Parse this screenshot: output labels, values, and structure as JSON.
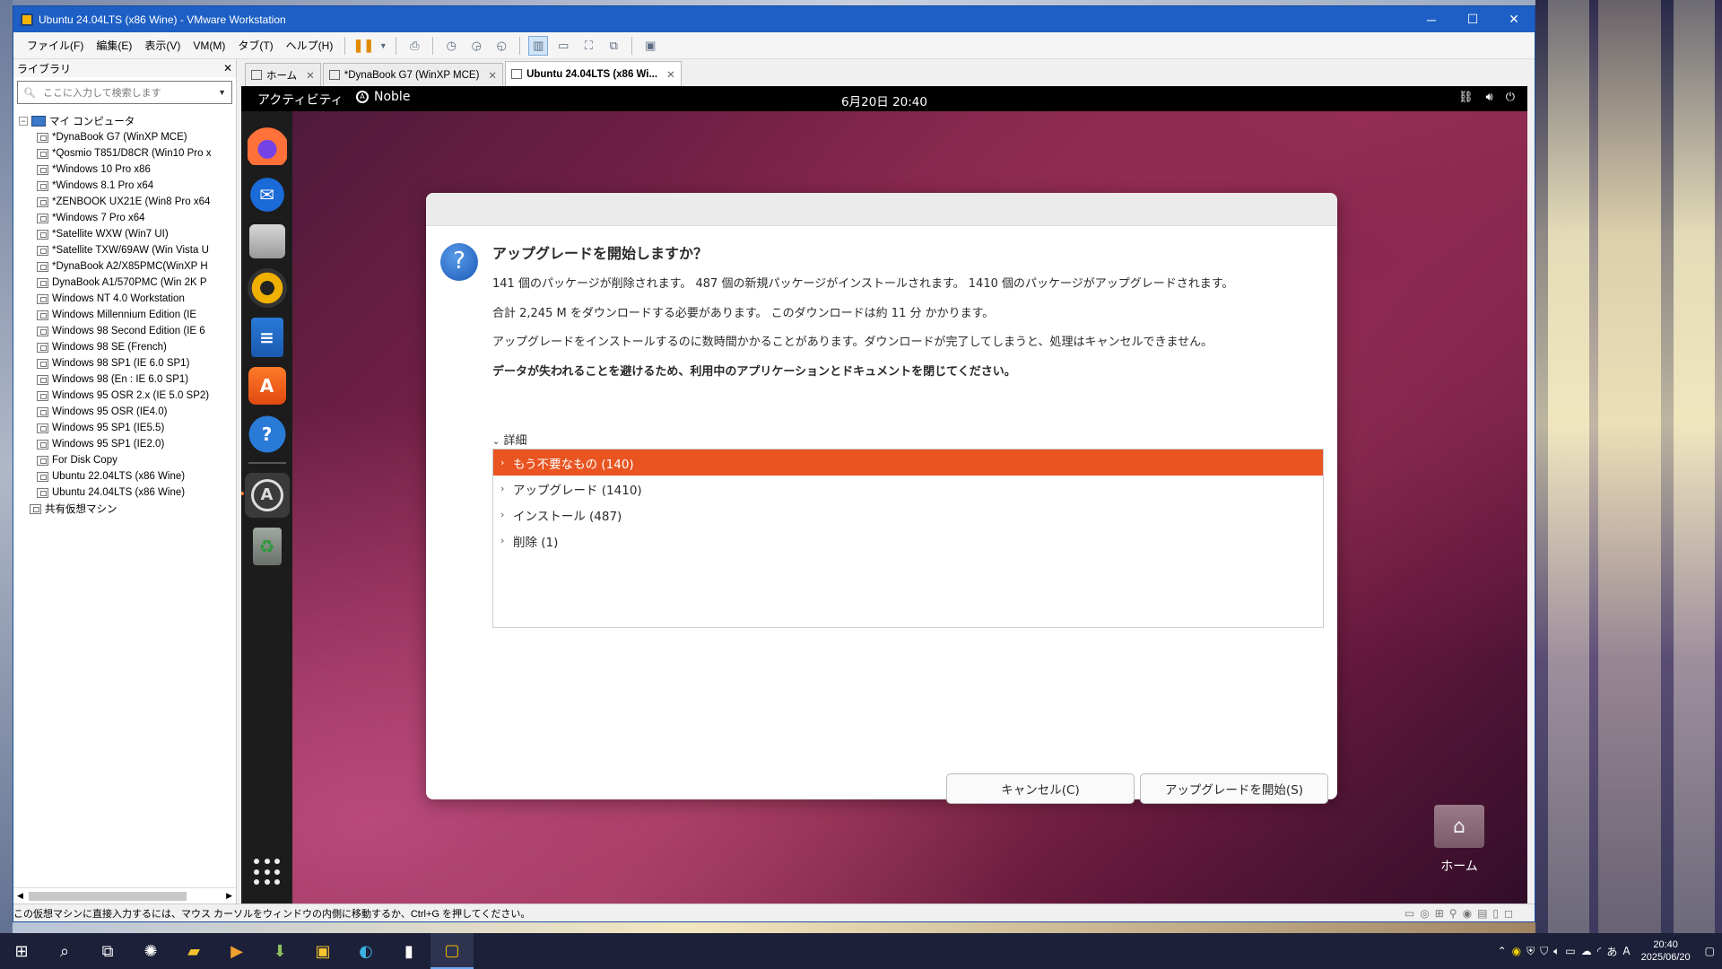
{
  "vmware": {
    "title": "Ubuntu 24.04LTS (x86 Wine) - VMware Workstation",
    "menu": [
      "ファイル(F)",
      "編集(E)",
      "表示(V)",
      "VM(M)",
      "タブ(T)",
      "ヘルプ(H)"
    ],
    "library": {
      "title": "ライブラリ",
      "search_placeholder": "ここに入力して検索します",
      "root": "マイ コンピュータ",
      "shared": "共有仮想マシン",
      "items": [
        "*DynaBook G7 (WinXP MCE)",
        "*Qosmio T851/D8CR (Win10 Pro x",
        "*Windows 10 Pro x86",
        "*Windows 8.1 Pro x64",
        "*ZENBOOK UX21E (Win8 Pro x64",
        "*Windows 7 Pro x64",
        "*Satellite WXW (Win7 UI)",
        "*Satellite TXW/69AW (Win Vista U",
        "*DynaBook A2/X85PMC(WinXP H",
        "DynaBook A1/570PMC (Win 2K P",
        "Windows NT 4.0 Workstation",
        "Windows Millennium Edition (IE",
        "Windows 98 Second Edition (IE 6",
        "Windows 98 SE (French)",
        "Windows 98 SP1 (IE 6.0 SP1)",
        "Windows 98 (En : IE 6.0 SP1)",
        "Windows 95 OSR 2.x (IE 5.0 SP2)",
        "Windows 95 OSR (IE4.0)",
        "Windows 95 SP1 (IE5.5)",
        "Windows 95 SP1 (IE2.0)",
        "For Disk Copy",
        "Ubuntu 22.04LTS (x86 Wine)",
        "Ubuntu 24.04LTS (x86 Wine)"
      ]
    },
    "tabs": [
      "ホーム",
      "*DynaBook G7 (WinXP MCE)",
      "Ubuntu 24.04LTS (x86 Wi..."
    ],
    "status_message": "この仮想マシンに直接入力するには、マウス カーソルをウィンドウの内側に移動するか、Ctrl+G を押してください。"
  },
  "ubuntu": {
    "activities": "アクティビティ",
    "workspace": "Noble",
    "clock": "6月20日  20:40",
    "desktop_home_label": "ホーム",
    "dialog": {
      "title": "アップグレードを開始しますか？",
      "line1": "141 個のパッケージが削除されます。 487 個の新規パッケージがインストールされます。 1410 個のパッケージがアップグレードされます。",
      "line2": "合計 2,245 M をダウンロードする必要があります。 このダウンロードは約 11 分 かかります。",
      "line3": "アップグレードをインストールするのに数時間かかることがあります。ダウンロードが完了してしまうと、処理はキャンセルできません。",
      "line4": "データが失われることを避けるため、利用中のアプリケーションとドキュメントを閉じてください。",
      "details_label": "詳細",
      "details": [
        "もう不要なもの (140)",
        "アップグレード (1410)",
        "インストール (487)",
        "削除 (1)"
      ],
      "cancel_button": "キャンセル(C)",
      "start_button": "アップグレードを開始(S)"
    }
  },
  "taskbar": {
    "time": "20:40",
    "date": "2025/06/20",
    "ime": "あ"
  },
  "colors": {
    "ubuntu_orange": "#e95420",
    "vmware_titlebar": "#1d5fc4"
  }
}
